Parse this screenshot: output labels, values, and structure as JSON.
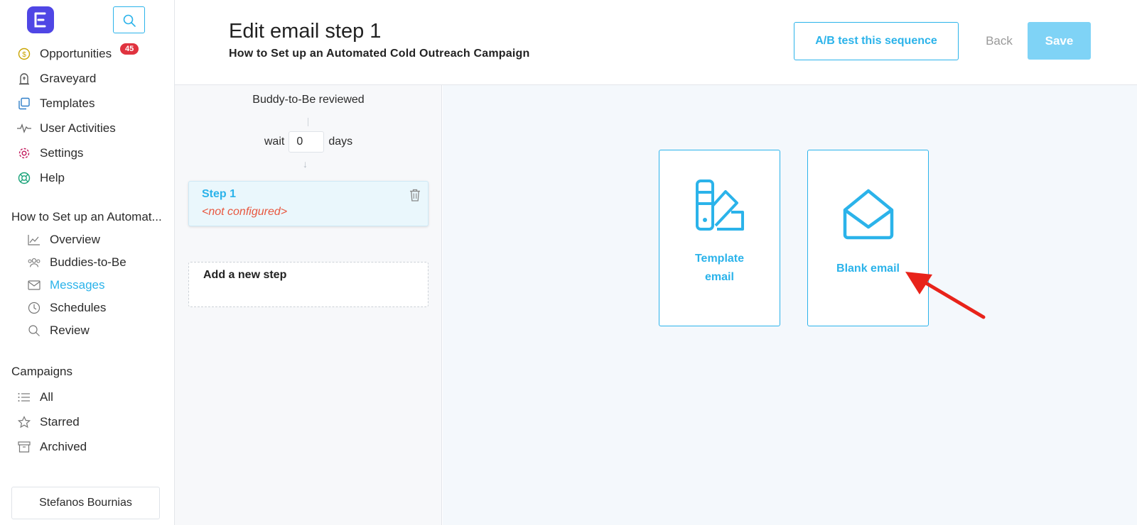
{
  "sidebar": {
    "nav": [
      {
        "label": "Opportunities",
        "icon": "dollar-circle-icon",
        "color": "#c9a400"
      },
      {
        "label": "Graveyard",
        "icon": "tombstone-icon",
        "color": "#555555"
      },
      {
        "label": "Templates",
        "icon": "templates-icon",
        "color": "#2f7fc9"
      },
      {
        "label": "User Activities",
        "icon": "activity-pulse-icon",
        "color": "#666666"
      },
      {
        "label": "Settings",
        "icon": "gear-icon",
        "color": "#c2185b"
      },
      {
        "label": "Help",
        "icon": "lifebuoy-icon",
        "color": "#1aa37a"
      }
    ],
    "opportunities_badge": "45",
    "campaign_section_title": "How to Set up an Automat...",
    "campaign_items": [
      {
        "label": "Overview",
        "icon": "chart-line-icon"
      },
      {
        "label": "Buddies-to-Be",
        "icon": "people-icon"
      },
      {
        "label": "Messages",
        "icon": "envelope-icon",
        "active": true
      },
      {
        "label": "Schedules",
        "icon": "clock-icon"
      },
      {
        "label": "Review",
        "icon": "magnifier-icon"
      }
    ],
    "campaigns_title": "Campaigns",
    "campaigns_items": [
      {
        "label": "All",
        "icon": "list-icon"
      },
      {
        "label": "Starred",
        "icon": "star-icon"
      },
      {
        "label": "Archived",
        "icon": "archive-box-icon"
      }
    ],
    "user_name": "Stefanos Bournias"
  },
  "header": {
    "title": "Edit email step 1",
    "subtitle": "How to Set up an Automated Cold Outreach Campaign",
    "ab_test_label": "A/B test this sequence",
    "back_label": "Back",
    "save_label": "Save"
  },
  "steps": {
    "trigger": "Buddy-to-Be reviewed",
    "wait_prefix": "wait",
    "wait_value": "0",
    "wait_suffix": "days",
    "step_name": "Step 1",
    "step_status": "<not configured>",
    "add_step_label": "Add a new step"
  },
  "choices": {
    "template_line1": "Template",
    "template_line2": "email",
    "blank_label": "Blank email"
  },
  "colors": {
    "accent": "#2bb3ea",
    "logo": "#4f46e5",
    "badge": "#e0333f",
    "annotation_arrow": "#e8231a"
  }
}
